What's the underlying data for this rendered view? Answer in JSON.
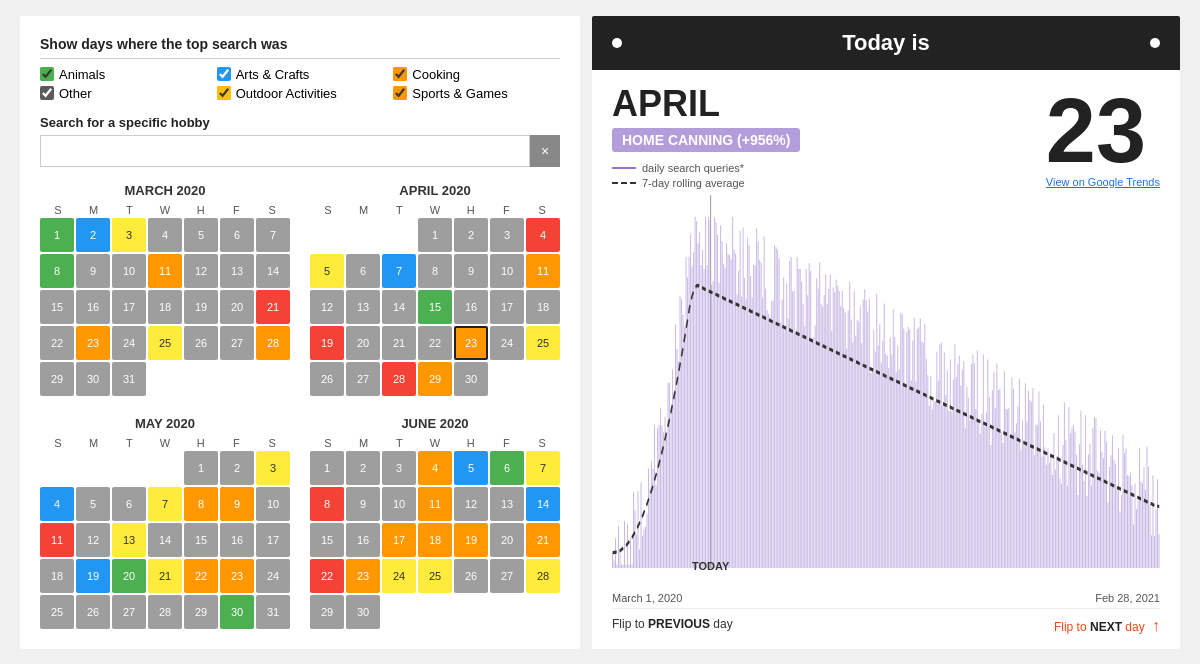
{
  "left": {
    "filter_title": "Show days where the top search was",
    "checkboxes": [
      {
        "label": "Animals",
        "checked": true,
        "color": "green"
      },
      {
        "label": "Arts & Crafts",
        "checked": true,
        "color": "blue"
      },
      {
        "label": "Cooking",
        "checked": true,
        "color": "orange"
      },
      {
        "label": "Other",
        "checked": true,
        "color": "gray"
      },
      {
        "label": "Outdoor Activities",
        "checked": true,
        "color": "yellow"
      },
      {
        "label": "Sports & Games",
        "checked": true,
        "color": "orange"
      }
    ],
    "search_label": "Search for a specific hobby",
    "search_placeholder": "",
    "search_clear": "×",
    "calendars": [
      {
        "title": "MARCH 2020",
        "days_header": [
          "S",
          "M",
          "T",
          "W",
          "H",
          "F",
          "S"
        ],
        "weeks": [
          [
            {
              "n": "1",
              "c": "green"
            },
            {
              "n": "2",
              "c": "blue"
            },
            {
              "n": "3",
              "c": "yellow"
            },
            {
              "n": "4",
              "c": "gray"
            },
            {
              "n": "5",
              "c": "gray"
            },
            {
              "n": "6",
              "c": "gray"
            },
            {
              "n": "7",
              "c": "gray"
            }
          ],
          [
            {
              "n": "8",
              "c": "green"
            },
            {
              "n": "9",
              "c": "gray"
            },
            {
              "n": "10",
              "c": "gray"
            },
            {
              "n": "11",
              "c": "orange"
            },
            {
              "n": "12",
              "c": "gray"
            },
            {
              "n": "13",
              "c": "gray"
            },
            {
              "n": "14",
              "c": "gray"
            }
          ],
          [
            {
              "n": "15",
              "c": "gray"
            },
            {
              "n": "16",
              "c": "gray"
            },
            {
              "n": "17",
              "c": "gray"
            },
            {
              "n": "18",
              "c": "gray"
            },
            {
              "n": "19",
              "c": "gray"
            },
            {
              "n": "20",
              "c": "gray"
            },
            {
              "n": "21",
              "c": "red"
            }
          ],
          [
            {
              "n": "22",
              "c": "gray"
            },
            {
              "n": "23",
              "c": "orange"
            },
            {
              "n": "24",
              "c": "gray"
            },
            {
              "n": "25",
              "c": "yellow"
            },
            {
              "n": "26",
              "c": "gray"
            },
            {
              "n": "27",
              "c": "gray"
            },
            {
              "n": "28",
              "c": "orange"
            }
          ],
          [
            {
              "n": "29",
              "c": "gray"
            },
            {
              "n": "30",
              "c": "gray"
            },
            {
              "n": "31",
              "c": "gray"
            },
            {
              "n": "",
              "c": "empty"
            },
            {
              "n": "",
              "c": "empty"
            },
            {
              "n": "",
              "c": "empty"
            },
            {
              "n": "",
              "c": "empty"
            }
          ]
        ]
      },
      {
        "title": "APRIL 2020",
        "days_header": [
          "S",
          "M",
          "T",
          "W",
          "H",
          "F",
          "S"
        ],
        "weeks": [
          [
            {
              "n": "",
              "c": "empty"
            },
            {
              "n": "",
              "c": "empty"
            },
            {
              "n": "",
              "c": "empty"
            },
            {
              "n": "1",
              "c": "gray"
            },
            {
              "n": "2",
              "c": "gray"
            },
            {
              "n": "3",
              "c": "gray"
            },
            {
              "n": "4",
              "c": "red"
            }
          ],
          [
            {
              "n": "5",
              "c": "yellow"
            },
            {
              "n": "6",
              "c": "gray"
            },
            {
              "n": "7",
              "c": "blue"
            },
            {
              "n": "8",
              "c": "gray"
            },
            {
              "n": "9",
              "c": "gray"
            },
            {
              "n": "10",
              "c": "gray"
            },
            {
              "n": "11",
              "c": "orange"
            }
          ],
          [
            {
              "n": "12",
              "c": "gray"
            },
            {
              "n": "13",
              "c": "gray"
            },
            {
              "n": "14",
              "c": "gray"
            },
            {
              "n": "15",
              "c": "green"
            },
            {
              "n": "16",
              "c": "gray"
            },
            {
              "n": "17",
              "c": "gray"
            },
            {
              "n": "18",
              "c": "gray"
            }
          ],
          [
            {
              "n": "19",
              "c": "red"
            },
            {
              "n": "20",
              "c": "gray"
            },
            {
              "n": "21",
              "c": "gray"
            },
            {
              "n": "22",
              "c": "gray"
            },
            {
              "n": "23",
              "c": "orange",
              "today": true
            },
            {
              "n": "24",
              "c": "gray"
            },
            {
              "n": "25",
              "c": "yellow"
            }
          ],
          [
            {
              "n": "26",
              "c": "gray"
            },
            {
              "n": "27",
              "c": "gray"
            },
            {
              "n": "28",
              "c": "red"
            },
            {
              "n": "29",
              "c": "orange"
            },
            {
              "n": "30",
              "c": "gray"
            },
            {
              "n": "",
              "c": "empty"
            },
            {
              "n": "",
              "c": "empty"
            }
          ]
        ]
      },
      {
        "title": "MAY 2020",
        "days_header": [
          "S",
          "M",
          "T",
          "W",
          "H",
          "F",
          "S"
        ],
        "weeks": [
          [
            {
              "n": "",
              "c": "empty"
            },
            {
              "n": "",
              "c": "empty"
            },
            {
              "n": "",
              "c": "empty"
            },
            {
              "n": "",
              "c": "empty"
            },
            {
              "n": "1",
              "c": "gray"
            },
            {
              "n": "2",
              "c": "gray"
            },
            {
              "n": "3",
              "c": "yellow"
            }
          ],
          [
            {
              "n": "4",
              "c": "blue"
            },
            {
              "n": "5",
              "c": "gray"
            },
            {
              "n": "6",
              "c": "gray"
            },
            {
              "n": "7",
              "c": "yellow"
            },
            {
              "n": "8",
              "c": "orange"
            },
            {
              "n": "9",
              "c": "orange"
            },
            {
              "n": "10",
              "c": "gray"
            }
          ],
          [
            {
              "n": "11",
              "c": "red"
            },
            {
              "n": "12",
              "c": "gray"
            },
            {
              "n": "13",
              "c": "yellow"
            },
            {
              "n": "14",
              "c": "gray"
            },
            {
              "n": "15",
              "c": "gray"
            },
            {
              "n": "16",
              "c": "gray"
            },
            {
              "n": "17",
              "c": "gray"
            }
          ],
          [
            {
              "n": "18",
              "c": "gray"
            },
            {
              "n": "19",
              "c": "blue"
            },
            {
              "n": "20",
              "c": "green"
            },
            {
              "n": "21",
              "c": "yellow"
            },
            {
              "n": "22",
              "c": "orange"
            },
            {
              "n": "23",
              "c": "orange"
            },
            {
              "n": "24",
              "c": "gray"
            }
          ],
          [
            {
              "n": "25",
              "c": "gray"
            },
            {
              "n": "26",
              "c": "gray"
            },
            {
              "n": "27",
              "c": "gray"
            },
            {
              "n": "28",
              "c": "gray"
            },
            {
              "n": "29",
              "c": "gray"
            },
            {
              "n": "30",
              "c": "green"
            },
            {
              "n": "31",
              "c": "gray"
            }
          ]
        ]
      },
      {
        "title": "JUNE 2020",
        "days_header": [
          "S",
          "M",
          "T",
          "W",
          "H",
          "F",
          "S"
        ],
        "weeks": [
          [
            {
              "n": "1",
              "c": "gray"
            },
            {
              "n": "2",
              "c": "gray"
            },
            {
              "n": "3",
              "c": "gray"
            },
            {
              "n": "4",
              "c": "orange"
            },
            {
              "n": "5",
              "c": "blue"
            },
            {
              "n": "6",
              "c": "green"
            },
            {
              "n": "7",
              "c": "yellow"
            }
          ],
          [
            {
              "n": "8",
              "c": "red"
            },
            {
              "n": "9",
              "c": "gray"
            },
            {
              "n": "10",
              "c": "gray"
            },
            {
              "n": "11",
              "c": "orange"
            },
            {
              "n": "12",
              "c": "gray"
            },
            {
              "n": "13",
              "c": "gray"
            },
            {
              "n": "14",
              "c": "blue"
            }
          ],
          [
            {
              "n": "15",
              "c": "gray"
            },
            {
              "n": "16",
              "c": "gray"
            },
            {
              "n": "17",
              "c": "orange"
            },
            {
              "n": "18",
              "c": "orange"
            },
            {
              "n": "19",
              "c": "orange"
            },
            {
              "n": "20",
              "c": "gray"
            },
            {
              "n": "21",
              "c": "orange"
            }
          ],
          [
            {
              "n": "22",
              "c": "red"
            },
            {
              "n": "23",
              "c": "orange"
            },
            {
              "n": "24",
              "c": "yellow"
            },
            {
              "n": "25",
              "c": "yellow"
            },
            {
              "n": "26",
              "c": "gray"
            },
            {
              "n": "27",
              "c": "gray"
            },
            {
              "n": "28",
              "c": "yellow"
            }
          ],
          [
            {
              "n": "29",
              "c": "gray"
            },
            {
              "n": "30",
              "c": "gray"
            },
            {
              "n": "",
              "c": "empty"
            },
            {
              "n": "",
              "c": "empty"
            },
            {
              "n": "",
              "c": "empty"
            },
            {
              "n": "",
              "c": "empty"
            },
            {
              "n": "",
              "c": "empty"
            }
          ]
        ]
      }
    ]
  },
  "right": {
    "header": "Today is",
    "month": "APRIL",
    "day": "23",
    "hobby_badge": "HOME CANNING (+956%)",
    "legend": [
      {
        "type": "solid",
        "label": "daily search queries*"
      },
      {
        "type": "dashed",
        "label": "7-day rolling average"
      }
    ],
    "google_trends_label": "View on Google Trends",
    "today_marker": "TODAY",
    "date_start": "March 1, 2020",
    "date_end": "Feb 28, 2021",
    "flip_prev": "Flip to PREVIOUS day",
    "flip_next": "Flip to NEXT day"
  }
}
